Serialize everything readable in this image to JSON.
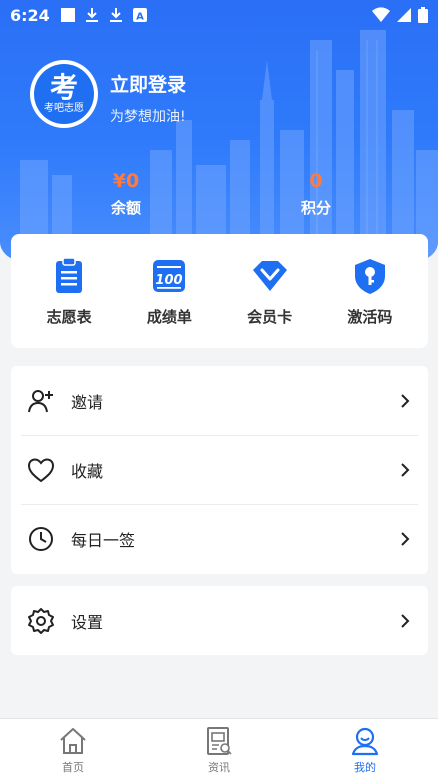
{
  "status_bar": {
    "time": "6:24",
    "left_icons": [
      "notification-square-icon",
      "download-icon",
      "download-icon",
      "a-badge-icon"
    ],
    "right_icons": [
      "wifi-icon",
      "signal-icon",
      "battery-icon"
    ]
  },
  "profile": {
    "avatar_char": "考",
    "avatar_caption": "考吧志愿",
    "title": "立即登录",
    "subtitle": "为梦想加油!"
  },
  "stats": {
    "balance": {
      "value": "¥0",
      "label": "余额"
    },
    "points": {
      "value": "0",
      "label": "积分"
    }
  },
  "quick_actions": [
    {
      "label": "志愿表",
      "icon": "clipboard-icon"
    },
    {
      "label": "成绩单",
      "icon": "score-100-icon"
    },
    {
      "label": "会员卡",
      "icon": "diamond-icon"
    },
    {
      "label": "激活码",
      "icon": "key-shield-icon"
    }
  ],
  "menu": [
    {
      "label": "邀请",
      "icon": "add-user-icon"
    },
    {
      "label": "收藏",
      "icon": "heart-icon"
    },
    {
      "label": "每日一签",
      "icon": "clock-icon"
    }
  ],
  "settings": {
    "label": "设置",
    "icon": "gear-icon"
  },
  "bottom_nav": [
    {
      "label": "首页",
      "icon": "home-icon",
      "active": false
    },
    {
      "label": "资讯",
      "icon": "news-icon",
      "active": false
    },
    {
      "label": "我的",
      "icon": "profile-icon",
      "active": true
    }
  ],
  "colors": {
    "primary": "#1f6ff2",
    "accent_value": "#ff7a3c",
    "background": "#f3f4f6"
  }
}
